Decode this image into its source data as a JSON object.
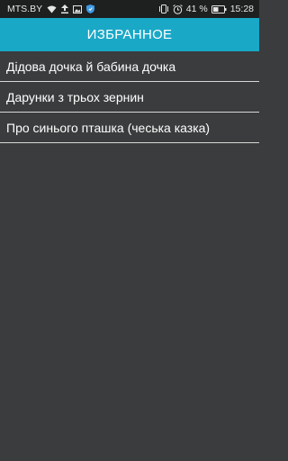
{
  "status_bar": {
    "carrier": "MTS.BY",
    "battery_percent": "41 %",
    "time": "15:28",
    "icons": [
      "wifi-icon",
      "upload-icon",
      "image-icon",
      "shield-icon",
      "vibrate-icon",
      "alarm-icon",
      "battery-icon"
    ]
  },
  "app_bar": {
    "title": "ИЗБРАННОЕ",
    "color": "#1aa8c7"
  },
  "favorites": [
    {
      "label": "Дідова дочка й бабина дочка"
    },
    {
      "label": "Дарунки з трьох зернин"
    },
    {
      "label": "Про синього пташка (чеська казка)"
    }
  ]
}
